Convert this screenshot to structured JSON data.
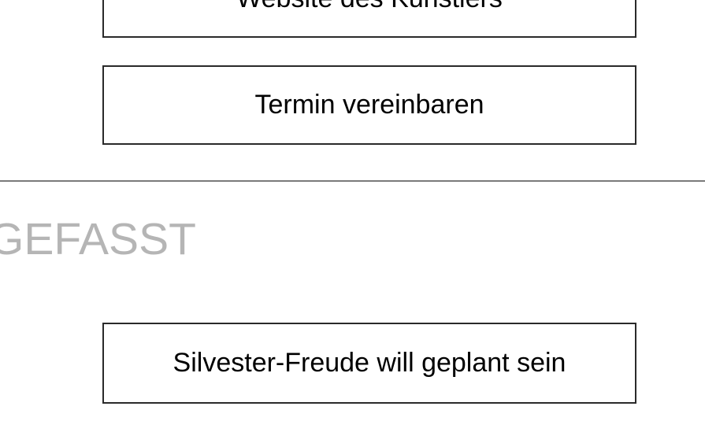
{
  "buttons": {
    "website_label": "Website des Künstlers",
    "appointment_label": "Termin vereinbaren",
    "silvester_label": "Silvester-Freude will geplant sein"
  },
  "section": {
    "heading": "GEFASST"
  },
  "colors": {
    "button_border": "#2a2a2a",
    "divider": "#7a7a7a",
    "heading_text": "#b5b5b5"
  }
}
